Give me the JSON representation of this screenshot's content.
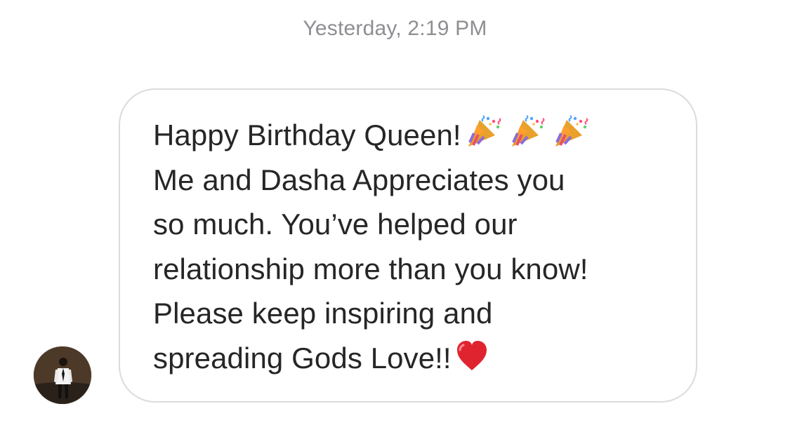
{
  "conversation": {
    "timestamp": "Yesterday, 2:19 PM",
    "message": {
      "lines": [
        "Happy Birthday Queen!",
        "Me and Dasha Appreciates you",
        "so much. You’ve helped our",
        "relationship more than you know!",
        "Please keep inspiring and",
        "spreading Gods Love!!"
      ],
      "emojis": {
        "line_1": [
          "party-popper-emoji",
          "party-popper-emoji",
          "party-popper-emoji"
        ],
        "line_6": [
          "red-heart-emoji"
        ]
      }
    },
    "sender": {
      "avatar_icon": "profile-avatar"
    }
  },
  "colors": {
    "background": "#ffffff",
    "bubble_border": "#dbdbdb",
    "text": "#262626",
    "timestamp": "#8e8e93",
    "heart": "#e0242f"
  }
}
